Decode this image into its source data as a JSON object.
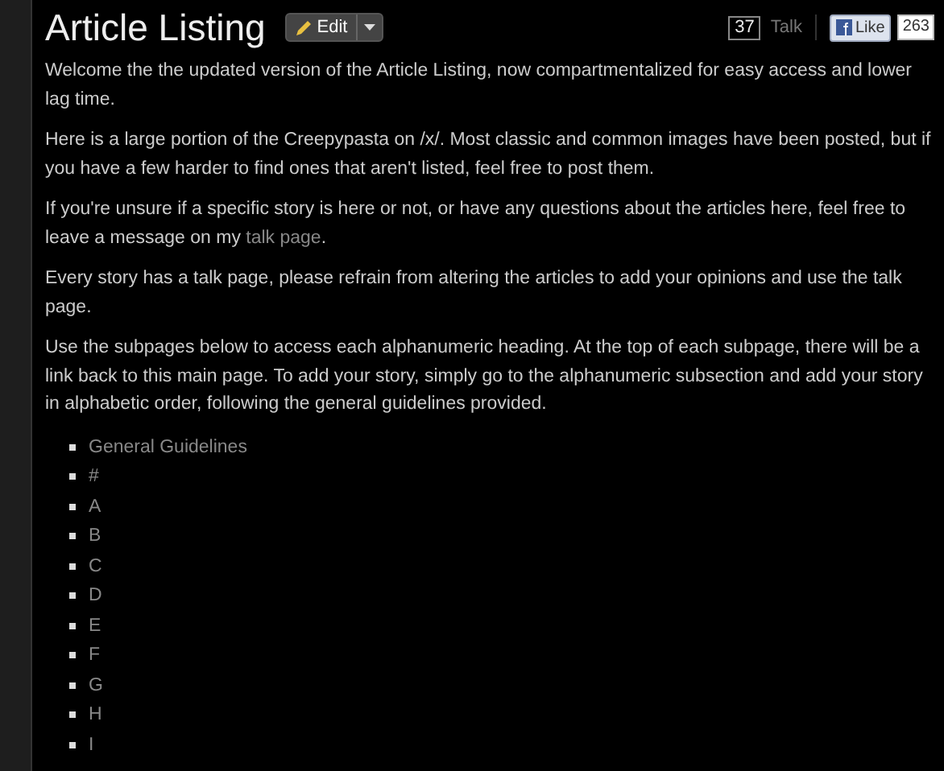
{
  "header": {
    "title": "Article Listing",
    "edit_button": "Edit",
    "talk_count": "37",
    "talk_label": "Talk",
    "like_button": "Like",
    "like_count": "263"
  },
  "paragraphs": [
    [
      {
        "text": "Welcome the the updated version of the Article Listing, now compartmentalized for easy access and lower lag time."
      }
    ],
    [
      {
        "text": "Here is a large portion of the Creepypasta on /x/. Most classic and common images have been posted, but if you have a few harder to find ones that aren't listed, feel free to post them."
      }
    ],
    [
      {
        "text": "If you're unsure if a specific story is here or not, or have any questions about the articles here, feel free to leave a message on my "
      },
      {
        "text": "talk page",
        "kind": "link"
      },
      {
        "text": "."
      }
    ],
    [
      {
        "text": "Every story has a talk page, please refrain from altering the articles to add your opinions and use the talk page."
      }
    ],
    [
      {
        "text": "Use the subpages below to access each alphanumeric heading. At the top of each subpage, there will be a link back to this main page. To add your story, simply go to the alphanumeric subsection and add your story in alphabetic order, following the general guidelines provided."
      }
    ]
  ],
  "links": [
    "General Guidelines",
    "#",
    "A",
    "B",
    "C",
    "D",
    "E",
    "F",
    "G",
    "H",
    "I"
  ]
}
